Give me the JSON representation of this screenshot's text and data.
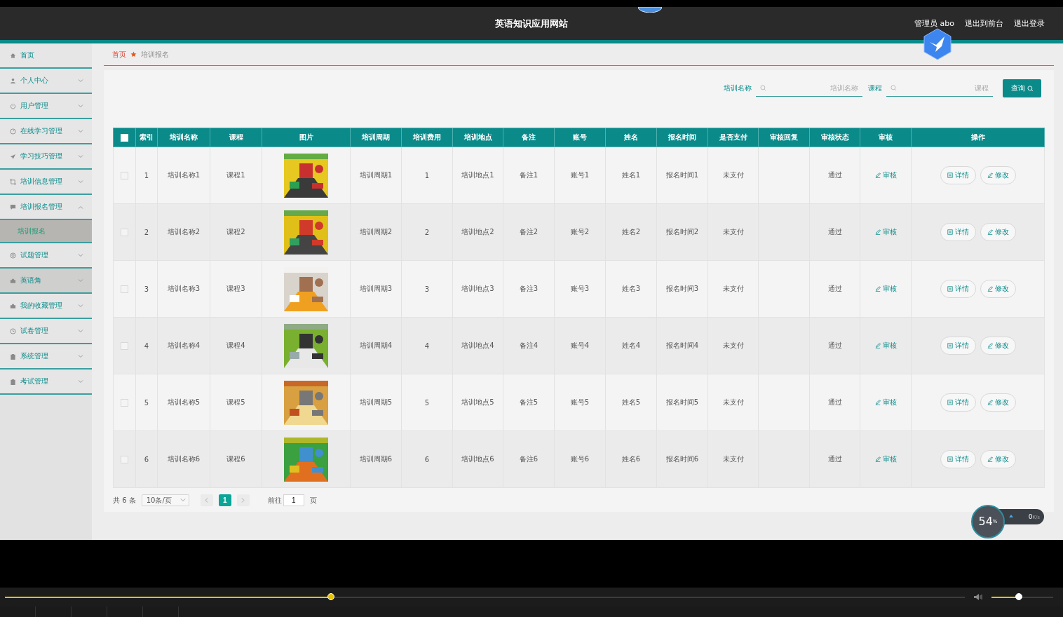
{
  "header": {
    "title": "英语知识应用网站",
    "links": [
      "管理员 abo",
      "退出到前台",
      "退出登录"
    ]
  },
  "sidebar": {
    "items": [
      {
        "label": "首页",
        "kind": "link",
        "hovered": false
      },
      {
        "label": "个人中心",
        "kind": "group",
        "expanded": false,
        "hovered": false
      },
      {
        "label": "用户管理",
        "kind": "group",
        "expanded": false,
        "hovered": false
      },
      {
        "label": "在线学习管理",
        "kind": "group",
        "expanded": false,
        "hovered": false
      },
      {
        "label": "学习技巧管理",
        "kind": "group",
        "expanded": false,
        "hovered": false
      },
      {
        "label": "培训信息管理",
        "kind": "group",
        "expanded": false,
        "hovered": false
      },
      {
        "label": "培训报名管理",
        "kind": "group",
        "expanded": true,
        "hovered": false,
        "children": [
          {
            "label": "培训报名",
            "selected": true
          }
        ]
      },
      {
        "label": "试题管理",
        "kind": "group",
        "expanded": false,
        "hovered": false
      },
      {
        "label": "英语角",
        "kind": "group",
        "expanded": false,
        "hovered": true
      },
      {
        "label": "我的收藏管理",
        "kind": "group",
        "expanded": false,
        "hovered": false
      },
      {
        "label": "试卷管理",
        "kind": "group",
        "expanded": false,
        "hovered": false
      },
      {
        "label": "系统管理",
        "kind": "group",
        "expanded": false,
        "hovered": false
      },
      {
        "label": "考试管理",
        "kind": "group",
        "expanded": false,
        "hovered": false
      }
    ]
  },
  "breadcrumb": [
    "首页",
    "培训报名"
  ],
  "search": {
    "fields": [
      {
        "label": "培训名称",
        "placeholder": "培训名称"
      },
      {
        "label": "课程",
        "placeholder": "课程"
      }
    ],
    "button": "查询"
  },
  "table": {
    "all_checked": false,
    "columns": [
      "索引",
      "培训名称",
      "课程",
      "图片",
      "培训周期",
      "培训费用",
      "培训地点",
      "备注",
      "账号",
      "姓名",
      "报名时间",
      "是否支付",
      "审核回复",
      "审核状态",
      "审核",
      "操作"
    ],
    "rows": [
      {
        "checked": false,
        "cells": [
          "1",
          "培训名称1",
          "课程1",
          {
            "kind": "picture"
          },
          "培训周期1",
          "1",
          "培训地点1",
          "备注1",
          "账号1",
          "姓名1",
          "报名时间1",
          "未支付",
          "",
          "通过"
        ],
        "review": "审核",
        "actions": [
          "详情",
          "修改"
        ]
      },
      {
        "checked": false,
        "cells": [
          "2",
          "培训名称2",
          "课程2",
          {
            "kind": "picture"
          },
          "培训周期2",
          "2",
          "培训地点2",
          "备注2",
          "账号2",
          "姓名2",
          "报名时间2",
          "未支付",
          "",
          "通过"
        ],
        "review": "审核",
        "actions": [
          "详情",
          "修改"
        ]
      },
      {
        "checked": false,
        "cells": [
          "3",
          "培训名称3",
          "课程3",
          {
            "kind": "picture"
          },
          "培训周期3",
          "3",
          "培训地点3",
          "备注3",
          "账号3",
          "姓名3",
          "报名时间3",
          "未支付",
          "",
          "通过"
        ],
        "review": "审核",
        "actions": [
          "详情",
          "修改"
        ]
      },
      {
        "checked": false,
        "cells": [
          "4",
          "培训名称4",
          "课程4",
          {
            "kind": "picture"
          },
          "培训周期4",
          "4",
          "培训地点4",
          "备注4",
          "账号4",
          "姓名4",
          "报名时间4",
          "未支付",
          "",
          "通过"
        ],
        "review": "审核",
        "actions": [
          "详情",
          "修改"
        ]
      },
      {
        "checked": false,
        "cells": [
          "5",
          "培训名称5",
          "课程5",
          {
            "kind": "picture"
          },
          "培训周期5",
          "5",
          "培训地点5",
          "备注5",
          "账号5",
          "姓名5",
          "报名时间5",
          "未支付",
          "",
          "通过"
        ],
        "review": "审核",
        "actions": [
          "详情",
          "修改"
        ]
      },
      {
        "checked": false,
        "cells": [
          "6",
          "培训名称6",
          "课程6",
          {
            "kind": "picture"
          },
          "培训周期6",
          "6",
          "培训地点6",
          "备注6",
          "账号6",
          "姓名6",
          "报名时间6",
          "未支付",
          "",
          "通过"
        ],
        "review": "审核",
        "actions": [
          "详情",
          "修改"
        ]
      }
    ]
  },
  "pagination": {
    "total": "共 6 条",
    "page_size": "10条/页",
    "pages": [
      {
        "label": "1",
        "selected": true
      }
    ],
    "goto_label": "前往",
    "goto_value": "1",
    "goto_suffix": "页"
  },
  "net_widget": {
    "percent": "54",
    "unit": "%",
    "speed": "0",
    "speed_unit": "K/s"
  },
  "player": {
    "progress": {
      "level": 0.34
    },
    "volume": {
      "level": 0.44
    }
  }
}
